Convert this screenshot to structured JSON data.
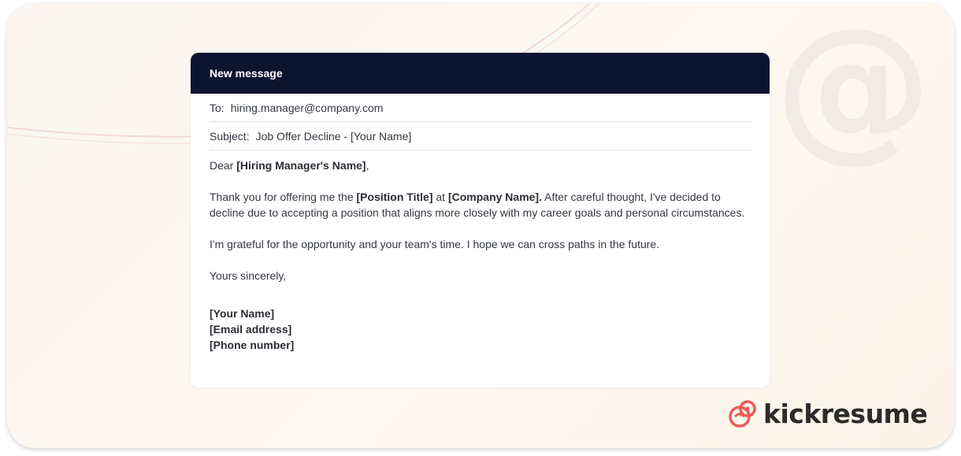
{
  "header": {
    "title": "New message"
  },
  "fields": {
    "to_label": "To:",
    "to_value": "hiring.manager@company.com",
    "subject_label": "Subject:",
    "subject_value": "Job Offer Decline - [Your Name]"
  },
  "message": {
    "greeting_prefix": "Dear ",
    "greeting_name": "[Hiring Manager's Name]",
    "greeting_suffix": ",",
    "p1_part1": "Thank you for offering me the ",
    "p1_position": "[Position Title]",
    "p1_part2": " at ",
    "p1_company": "[Company Name].",
    "p1_part3": " After careful thought, I've decided to decline due to accepting a position that aligns more closely with my career goals and personal circumstances.",
    "p2": "I'm grateful for the opportunity and your team's time. I hope we can cross paths in the future.",
    "closing": "Yours sincerely,"
  },
  "signature": {
    "name": "[Your Name]",
    "email": "[Email address]",
    "phone": "[Phone number]"
  },
  "brand": {
    "name": "kickresume",
    "icon": "kickresume-logo-icon"
  },
  "decoration": {
    "icon": "at-sign-icon",
    "glyph": "@"
  },
  "colors": {
    "header_bg": "#0b1530",
    "brand_accent": "#ef5a55",
    "text": "#333740"
  }
}
